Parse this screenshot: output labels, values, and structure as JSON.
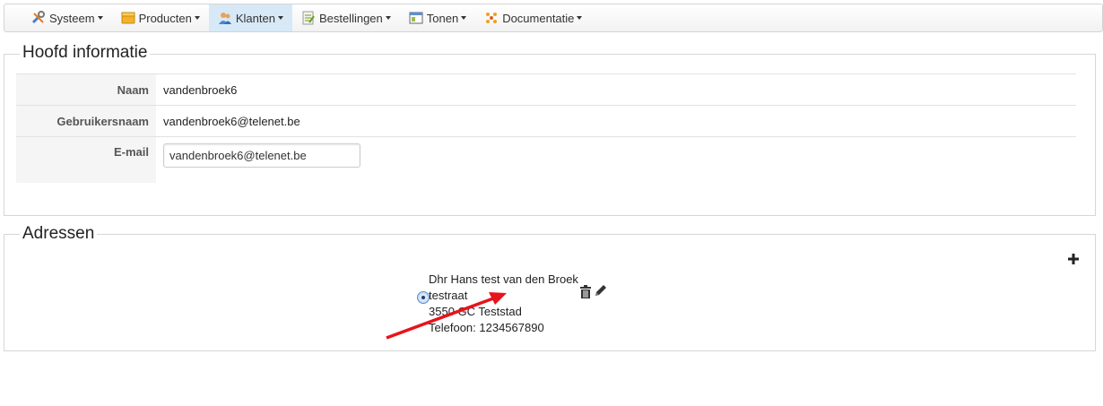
{
  "nav": {
    "items": [
      {
        "label": "Systeem",
        "icon": "tools-icon"
      },
      {
        "label": "Producten",
        "icon": "box-icon"
      },
      {
        "label": "Klanten",
        "icon": "users-icon",
        "active": true
      },
      {
        "label": "Bestellingen",
        "icon": "orders-icon"
      },
      {
        "label": "Tonen",
        "icon": "window-icon"
      },
      {
        "label": "Documentatie",
        "icon": "docs-icon"
      }
    ]
  },
  "main_info": {
    "title": "Hoofd informatie",
    "name_label": "Naam",
    "name_value": "vandenbroek6",
    "username_label": "Gebruikersnaam",
    "username_value": "vandenbroek6@telenet.be",
    "email_label": "E-mail",
    "email_value": "vandenbroek6@telenet.be"
  },
  "addresses": {
    "title": "Adressen",
    "entry": {
      "name": "Dhr Hans test van den Broek",
      "street": "testraat",
      "city": "3550 GC Teststad",
      "phone": "Telefoon: 1234567890"
    }
  },
  "colors": {
    "active_nav": "#d7e9f7",
    "annotation_arrow": "#e8131b"
  }
}
